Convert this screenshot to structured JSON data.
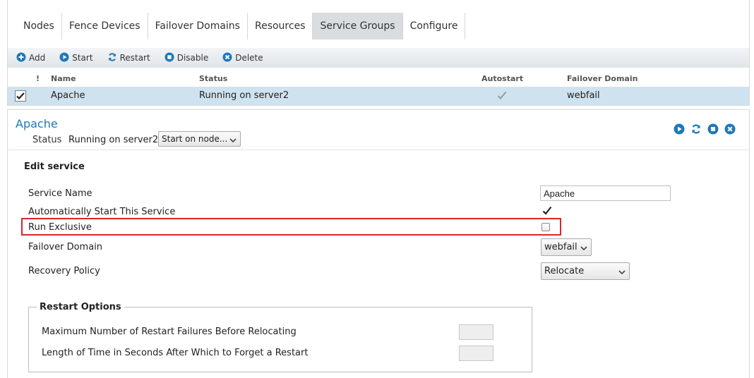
{
  "tabs": [
    {
      "label": "Nodes"
    },
    {
      "label": "Fence Devices"
    },
    {
      "label": "Failover Domains"
    },
    {
      "label": "Resources"
    },
    {
      "label": "Service Groups",
      "active": true
    },
    {
      "label": "Configure"
    }
  ],
  "toolbar": {
    "add_label": "Add",
    "start_label": "Start",
    "restart_label": "Restart",
    "disable_label": "Disable",
    "delete_label": "Delete"
  },
  "grid": {
    "columns": {
      "flag": "!",
      "name": "Name",
      "status": "Status",
      "autostart": "Autostart",
      "failover": "Failover Domain"
    },
    "rows": [
      {
        "name": "Apache",
        "status": "Running on server2",
        "autostart": true,
        "failover": "webfail",
        "selected": true
      }
    ]
  },
  "detail": {
    "title": "Apache",
    "status_label": "Status",
    "status_value": "Running on server2",
    "start_on_node": "Start on node..."
  },
  "edit": {
    "heading": "Edit service",
    "service_name_label": "Service Name",
    "service_name_value": "Apache",
    "autostart_label": "Automatically Start This Service",
    "autostart_checked": true,
    "run_exclusive_label": "Run Exclusive",
    "run_exclusive_checked": false,
    "failover_domain_label": "Failover Domain",
    "failover_domain_value": "webfail",
    "recovery_policy_label": "Recovery Policy",
    "recovery_policy_value": "Relocate"
  },
  "restart_options": {
    "legend": "Restart Options",
    "max_failures_label": "Maximum Number of Restart Failures Before Relocating",
    "forget_time_label": "Length of Time in Seconds After Which to Forget a Restart"
  },
  "colors": {
    "accent_blue": "#1d78b7",
    "selected_row": "#cfe2ef",
    "highlight_red": "#d9262c"
  }
}
